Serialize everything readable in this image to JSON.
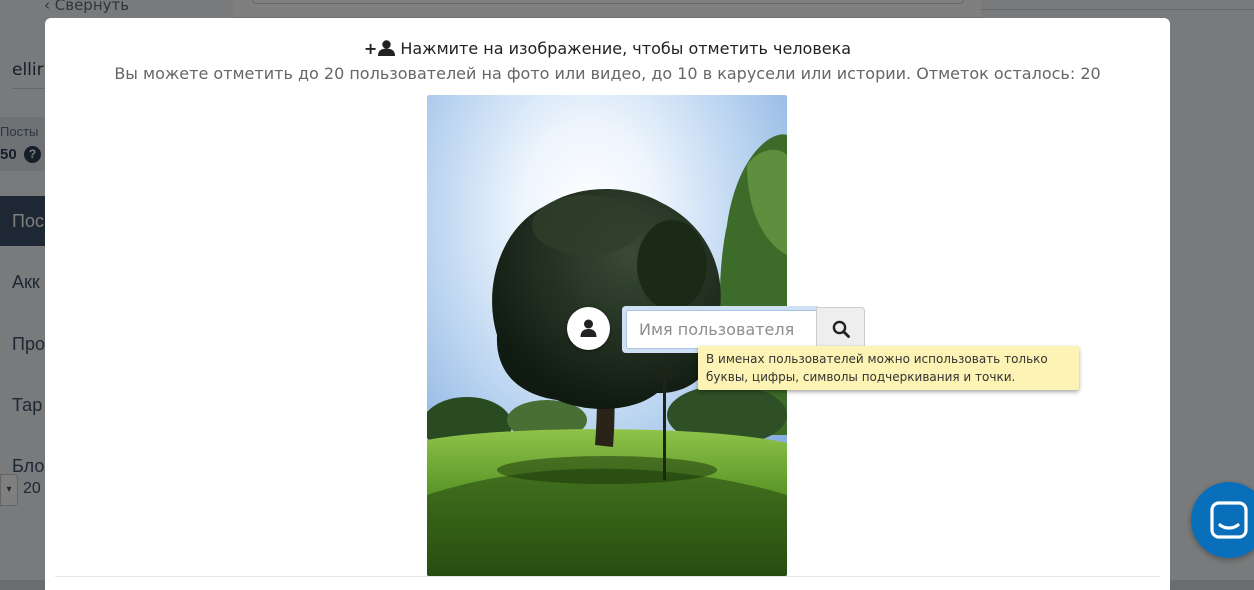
{
  "background": {
    "collapse_label": "‹ Свернуть",
    "account_name": "ellir",
    "stats_label": "Посты",
    "stats_value": "50",
    "nav_items": [
      "Пос",
      "Акк",
      "Про",
      "Тар",
      "Бло"
    ],
    "select_value": "20"
  },
  "modal": {
    "heading_plus": "+",
    "heading_icon": "user-icon",
    "heading": "Нажмите на изображение, чтобы отметить человека",
    "subheading": "Вы можете отметить до 20 пользователей на фото или видео, до 10 в карусели или истории. Отметок осталось: 20",
    "photo": {
      "description_icon": "tree-photo"
    },
    "tag_marker_icon": "user-icon",
    "search": {
      "placeholder": "Имя пользователя",
      "value": "",
      "button_icon": "search-icon"
    },
    "tooltip": "В именах пользователей можно использовать только буквы, цифры, символы подчеркивания и точки."
  },
  "chat_widget": {
    "icon": "chat-icon",
    "color": "#0a6fba"
  },
  "colors": {
    "overlay": "rgba(0,0,0,0.5)",
    "tooltip_bg": "#fcf3b4",
    "input_focus": "#a9c5e6"
  }
}
